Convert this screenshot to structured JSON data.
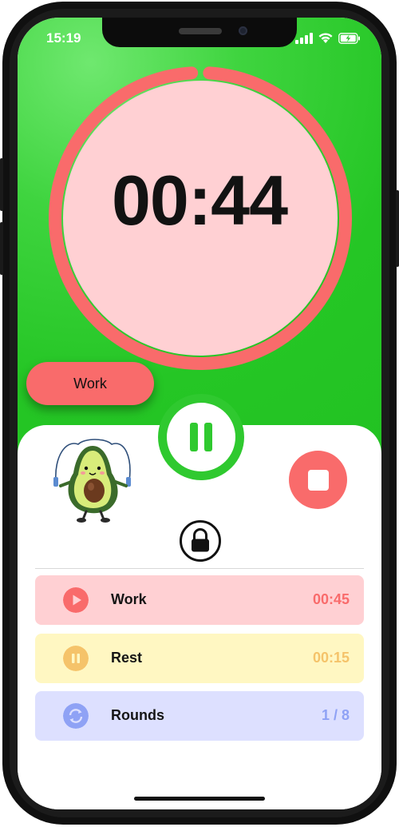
{
  "status_bar": {
    "time": "15:19"
  },
  "timer": {
    "display": "00:44",
    "progress_fraction": 0.98,
    "ring_color": "#f96b6b",
    "face_color": "#ffd0d3"
  },
  "mode_pill": {
    "label": "Work"
  },
  "intervals": [
    {
      "label": "Work",
      "value": "00:45",
      "bg": "#ffd0d3",
      "accent": "#f96b6b",
      "icon": "play-icon"
    },
    {
      "label": "Rest",
      "value": "00:15",
      "bg": "#fff7c2",
      "accent": "#f5c36a",
      "icon": "pause-icon"
    },
    {
      "label": "Rounds",
      "value": "1 / 8",
      "bg": "#dde0ff",
      "accent": "#8fa2f5",
      "icon": "repeat-icon"
    }
  ],
  "colors": {
    "green": "#2fc92f",
    "red": "#f96b6b"
  }
}
